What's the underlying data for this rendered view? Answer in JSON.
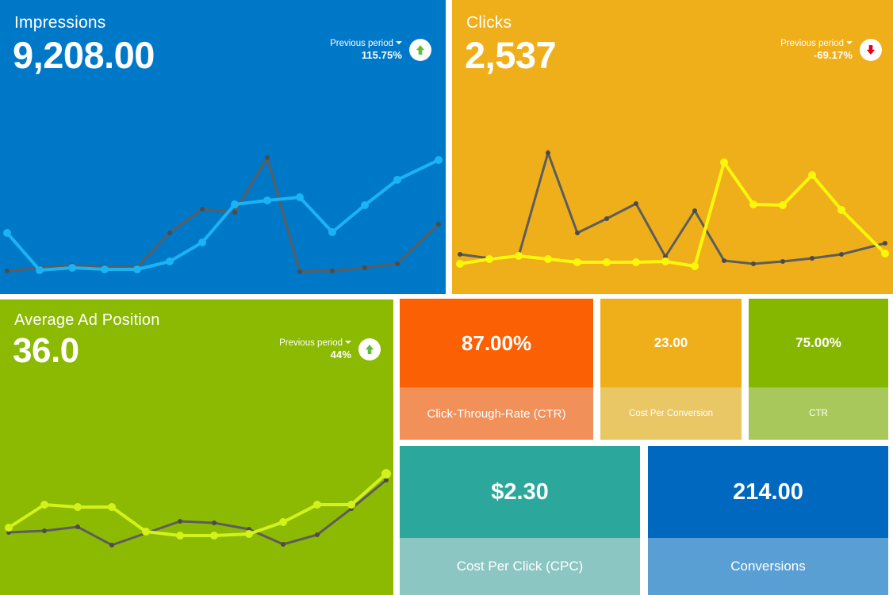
{
  "theme": {
    "background": "#ffffff",
    "blue": "#0078c8",
    "blue_light_line": "#1ab4f5",
    "gold": "#efaf1a",
    "yellow_line": "#fbf70a",
    "green": "#8cba02",
    "green_line": "#d3f21a",
    "prev_line": "#5d5d5d",
    "orange": "#fc6004",
    "orange_light": "#f29059",
    "gold_light": "#e9c765",
    "green_light": "#a9c85c",
    "teal": "#2ba79b",
    "teal_light": "#8cc6c3",
    "blue_dark": "#0068bf",
    "blue_soft": "#5a9fd4",
    "up_arrow": "#5fbe3f",
    "down_arrow": "#e2011a"
  },
  "tiles": {
    "impressions": {
      "title": "Impressions",
      "value": "9,208.00",
      "comparison_label": "Previous period",
      "comparison_value": "115.75%",
      "direction": "up"
    },
    "clicks": {
      "title": "Clicks",
      "value": "2,537",
      "comparison_label": "Previous period",
      "comparison_value": "-69.17%",
      "direction": "down"
    },
    "average_ad_position": {
      "title": "Average Ad Position",
      "value": "36.0",
      "comparison_label": "Previous period",
      "comparison_value": "44%",
      "direction": "up"
    },
    "ctr_large": {
      "value": "87.00%",
      "label": "Click-Through-Rate (CTR)"
    },
    "cost_per_conversion": {
      "value": "23.00",
      "label": "Cost Per Conversion"
    },
    "ctr_small": {
      "value": "75.00%",
      "label": "CTR"
    },
    "cost_per_click": {
      "value": "$2.30",
      "label": "Cost Per Click (CPC)"
    },
    "conversions": {
      "value": "214.00",
      "label": "Conversions"
    }
  },
  "chart_data": [
    {
      "type": "line",
      "title": "Impressions",
      "xlabel": "",
      "ylabel": "",
      "grid": false,
      "legend": "none",
      "x": [
        0,
        1,
        2,
        3,
        4,
        5,
        6,
        7,
        8,
        9,
        10,
        11,
        12
      ],
      "ylim": [
        0,
        100
      ],
      "series": [
        {
          "name": "Current period",
          "color": "#1ab4f5",
          "values": [
            21,
            8,
            10,
            9,
            9,
            13,
            25,
            53,
            58,
            61,
            32,
            62,
            83
          ]
        },
        {
          "name": "Previous period",
          "color": "#5d5d5d",
          "values": [
            7,
            9,
            10,
            9,
            9,
            33,
            55,
            53,
            96,
            7,
            7,
            9,
            12,
            48
          ]
        }
      ]
    },
    {
      "type": "line",
      "title": "Clicks",
      "xlabel": "",
      "ylabel": "",
      "grid": false,
      "legend": "none",
      "x": [
        0,
        1,
        2,
        3,
        4,
        5,
        6,
        7,
        8,
        9,
        10,
        11,
        12
      ],
      "ylim": [
        0,
        100
      ],
      "series": [
        {
          "name": "Current period",
          "color": "#fbf70a",
          "values": [
            6,
            12,
            14,
            11,
            7,
            7,
            7,
            8,
            3,
            83,
            44,
            45,
            67,
            32,
            5
          ]
        },
        {
          "name": "Previous period",
          "color": "#5d5d5d",
          "values": [
            13,
            8,
            11,
            91,
            26,
            36,
            47,
            9,
            35,
            6,
            5,
            7,
            10
          ]
        }
      ]
    },
    {
      "type": "line",
      "title": "Average Ad Position",
      "xlabel": "",
      "ylabel": "",
      "grid": false,
      "legend": "none",
      "x": [
        0,
        1,
        2,
        3,
        4,
        5,
        6,
        7,
        8,
        9,
        10,
        11,
        12,
        13
      ],
      "ylim": [
        0,
        100
      ],
      "series": [
        {
          "name": "Current period",
          "color": "#d3f21a",
          "values": [
            57,
            75,
            73,
            73,
            53,
            46,
            46,
            47,
            59,
            74,
            74,
            95
          ]
        },
        {
          "name": "Previous period",
          "color": "#5d5d5d",
          "values": [
            53,
            57,
            62,
            38,
            53,
            59,
            56,
            54,
            34,
            42,
            68,
            91
          ]
        }
      ]
    }
  ]
}
